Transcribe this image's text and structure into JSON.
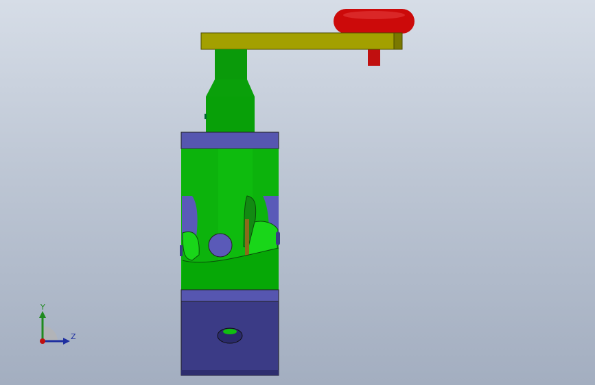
{
  "viewport": {
    "background_top": "#d6dde7",
    "background_bottom": "#a3aec0"
  },
  "model": {
    "knob_color": "#cc0a0a",
    "handle_color": "#a3a000",
    "shaft_color": "#0ea00e",
    "body_color": "#1ec81e",
    "cap_color": "#5656b0",
    "base_color": "#3b3b86"
  },
  "triad": {
    "y_label": "Y",
    "z_label": "Z",
    "y_axis_color": "#1f8a1f",
    "z_axis_color": "#1f2fa0",
    "x_axis_color": "#c01010"
  }
}
